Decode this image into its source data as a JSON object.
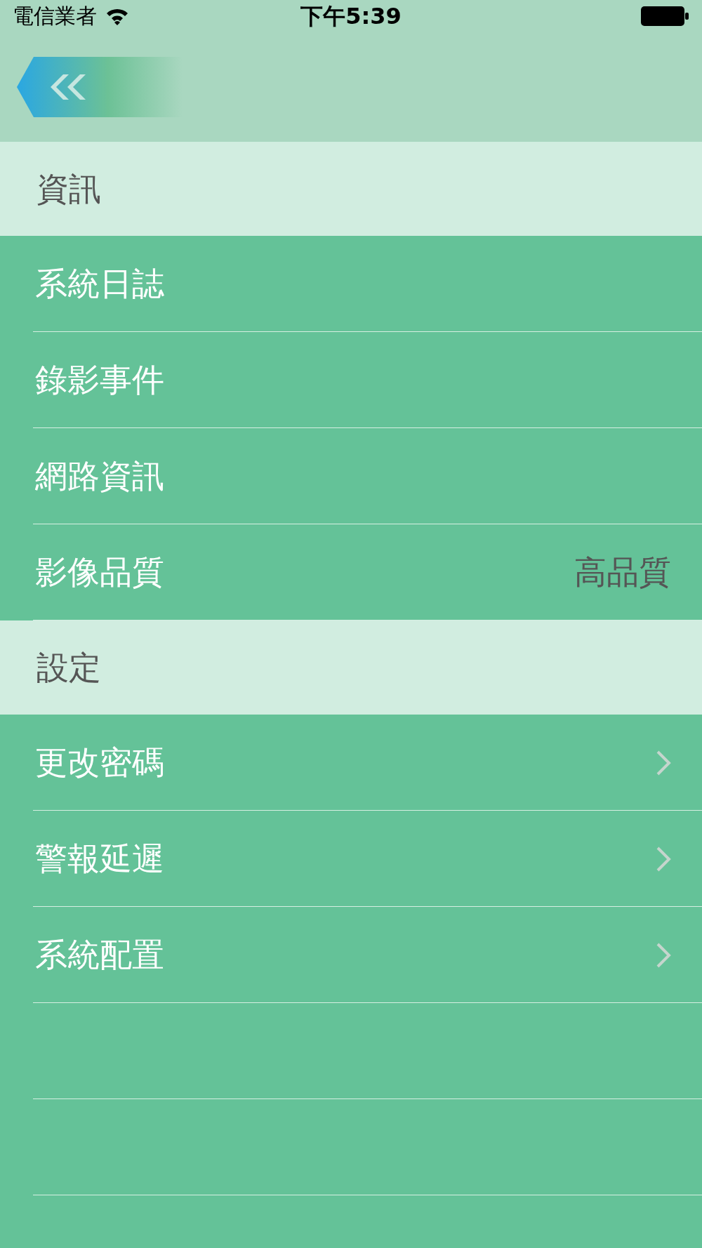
{
  "status_bar": {
    "carrier": "電信業者",
    "time": "下午5:39"
  },
  "sections": [
    {
      "title": "資訊",
      "rows": [
        {
          "label": "系統日誌",
          "kind": "plain"
        },
        {
          "label": "錄影事件",
          "kind": "plain"
        },
        {
          "label": "網路資訊",
          "kind": "plain"
        },
        {
          "label": "影像品質",
          "kind": "value",
          "value": "高品質"
        }
      ]
    },
    {
      "title": "設定",
      "rows": [
        {
          "label": "更改密碼",
          "kind": "disclosure"
        },
        {
          "label": "警報延遲",
          "kind": "disclosure"
        },
        {
          "label": "系統配置",
          "kind": "disclosure"
        }
      ]
    }
  ]
}
